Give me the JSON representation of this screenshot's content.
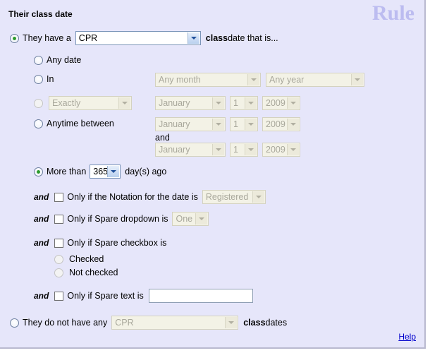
{
  "panel": {
    "title": "Their class date",
    "watermark": "Rule",
    "help_label": "Help",
    "bg_color": "#e6e6fa",
    "accent_color": "#2e9b2e",
    "link_color": "#0000cc",
    "watermark_color": "#bcbcf0"
  },
  "primary": {
    "radio_selected": true,
    "prefix_label": "They have a",
    "type_select_value": "CPR",
    "suffix_bold": "class",
    "suffix_rest": " date that is..."
  },
  "options": {
    "any_date": {
      "label": "Any date",
      "selected": false
    },
    "in": {
      "label": "In",
      "selected": false,
      "month_value": "Any month",
      "year_value": "Any year",
      "disabled": true
    },
    "exactly": {
      "selected": false,
      "qualifier_value": "Exactly",
      "month_value": "January",
      "day_value": "1",
      "year_value": "2009",
      "disabled": true
    },
    "anytime_between": {
      "label": "Anytime between",
      "selected": false,
      "and_label": "and",
      "from": {
        "month_value": "January",
        "day_value": "1",
        "year_value": "2009"
      },
      "to": {
        "month_value": "January",
        "day_value": "1",
        "year_value": "2009"
      },
      "disabled": true
    },
    "more_than": {
      "selected": true,
      "prefix_label": "More than",
      "days_value": "365",
      "suffix_label": "day(s) ago"
    }
  },
  "conditions": {
    "notation": {
      "and_label": "and",
      "checked": false,
      "label": "Only if the Notation for the date is",
      "select_value": "Registered",
      "disabled": true
    },
    "spare_dropdown": {
      "and_label": "and",
      "checked": false,
      "label": "Only if Spare dropdown is",
      "select_value": "One",
      "disabled": true
    },
    "spare_checkbox": {
      "and_label": "and",
      "checked": false,
      "label": "Only if Spare checkbox is",
      "radio_checked_label": "Checked",
      "radio_not_checked_label": "Not checked",
      "radio_checked_selected": false,
      "radio_not_checked_selected": false,
      "disabled": true
    },
    "spare_text": {
      "and_label": "and",
      "checked": false,
      "label": "Only if Spare text is",
      "value": "",
      "placeholder": ""
    }
  },
  "negative": {
    "radio_selected": false,
    "prefix_label": "They do not have any",
    "type_select_value": "CPR",
    "suffix_bold": "class",
    "suffix_rest": " dates",
    "disabled": true
  }
}
